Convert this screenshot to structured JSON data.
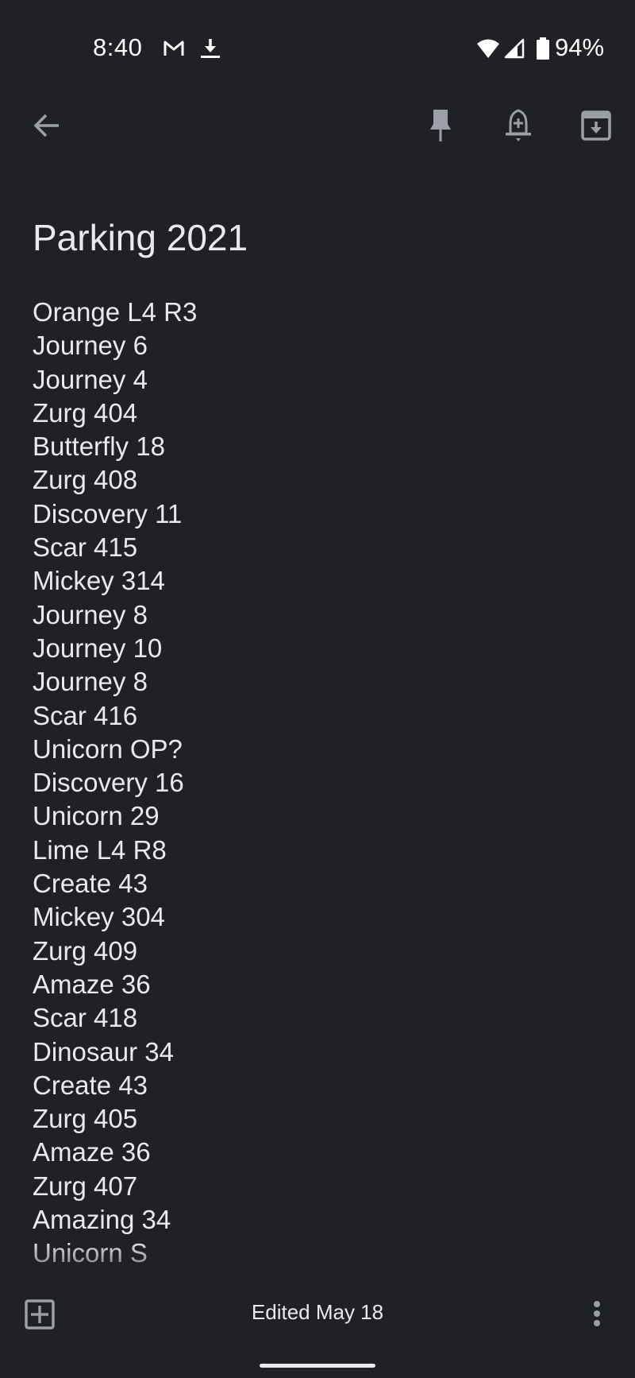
{
  "status_bar": {
    "time": "8:40",
    "notification_icons": [
      "gmail-icon",
      "download-icon"
    ],
    "system_icons": [
      "wifi-icon",
      "cellular-signal-icon",
      "battery-icon"
    ],
    "battery_percent": "94%"
  },
  "toolbar": {
    "back_icon": "arrow-back-icon",
    "actions": [
      "pin-icon",
      "add-reminder-icon",
      "archive-icon"
    ]
  },
  "note": {
    "title": "Parking 2021",
    "lines": [
      "Orange L4 R3",
      "Journey 6",
      "Journey 4",
      "Zurg 404",
      "Butterfly 18",
      "Zurg 408",
      "Discovery 11",
      "Scar 415",
      "Mickey 314",
      "Journey 8",
      "Journey 10",
      "Journey 8",
      "Scar 416",
      "Unicorn OP?",
      "Discovery 16",
      "Unicorn 29",
      "Lime L4 R8",
      "Create 43",
      "Mickey 304",
      "Zurg 409",
      "Amaze 36",
      "Scar 418",
      "Dinosaur 34",
      "Create 43",
      "Zurg 405",
      "Amaze 36",
      "Zurg 407",
      "Amazing 34",
      "Unicorn S"
    ]
  },
  "bottom_bar": {
    "add_icon": "add-box-icon",
    "edited_label": "Edited May 18",
    "more_icon": "more-vert-icon"
  },
  "colors": {
    "background": "#202124",
    "text": "#e8eaed",
    "icon": "#9aa0a6"
  }
}
